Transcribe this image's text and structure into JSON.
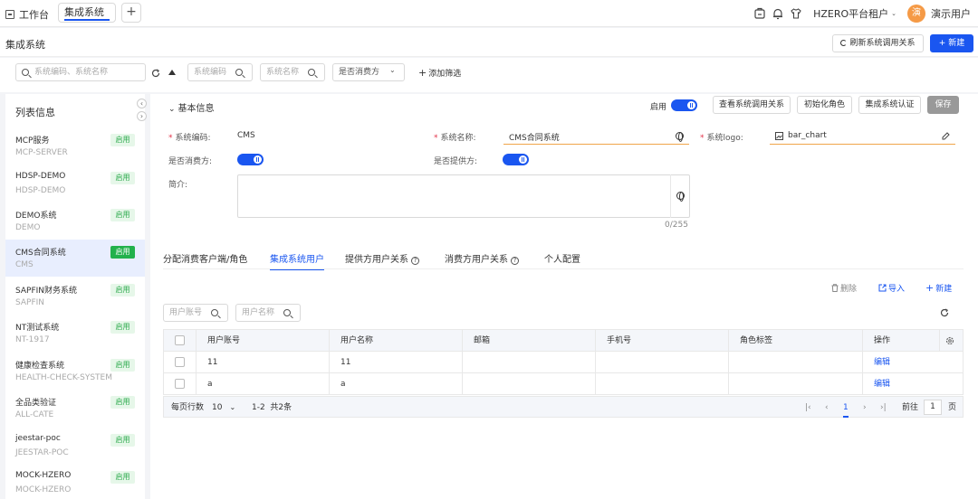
{
  "topbar": {
    "home_label": "工作台",
    "active_tab": "集成系统",
    "add_tab": "+",
    "tenant": "HZERO平台租户",
    "avatar_text": "演",
    "user_name": "演示用户"
  },
  "header": {
    "title": "集成系统",
    "refresh_label": "刷新系统调用关系",
    "new_label": "+ 新建"
  },
  "filters": {
    "search_placeholder": "系统编码、系统名称",
    "code_placeholder": "系统编码",
    "name_placeholder": "系统名称",
    "consumer_select": "是否消费方",
    "add_filter": "添加筛选"
  },
  "sidebar": {
    "title": "列表信息",
    "items": [
      {
        "name": "MCP服务",
        "code": "MCP-SERVER",
        "status": "启用"
      },
      {
        "name": "HDSP-DEMO",
        "code": "HDSP-DEMO",
        "status": "启用"
      },
      {
        "name": "DEMO系统",
        "code": "DEMO",
        "status": "启用"
      },
      {
        "name": "CMS合同系统",
        "code": "CMS",
        "status": "启用"
      },
      {
        "name": "SAPFIN财务系统",
        "code": "SAPFIN",
        "status": "启用"
      },
      {
        "name": "NT测试系统",
        "code": "NT-1917",
        "status": "启用"
      },
      {
        "name": "健康检查系统",
        "code": "HEALTH-CHECK-SYSTEM",
        "status": "启用"
      },
      {
        "name": "全品类验证",
        "code": "ALL-CATE",
        "status": "启用"
      },
      {
        "name": "jeestar-poc",
        "code": "JEESTAR-POC",
        "status": "启用"
      },
      {
        "name": "MOCK-HZERO",
        "code": "MOCK-HZERO",
        "status": "启用"
      }
    ]
  },
  "basic": {
    "section_title": "基本信息",
    "enabled_label": "启用",
    "btn_view_relations": "查看系统调用关系",
    "btn_init_roles": "初始化角色",
    "btn_auth": "集成系统认证",
    "btn_save": "保存",
    "code_label": "系统编码:",
    "code_value": "CMS",
    "name_label": "系统名称:",
    "name_value": "CMS合同系统",
    "logo_label": "系统logo:",
    "logo_value": "bar_chart",
    "consumer_label": "是否消费方:",
    "provider_label": "是否提供方:",
    "intro_label": "简介:",
    "intro_count": "0/255"
  },
  "tabs": [
    "分配消费客户端/角色",
    "集成系统用户",
    "提供方用户关系",
    "消费方用户关系",
    "个人配置"
  ],
  "actions": {
    "delete": "删除",
    "import": "导入",
    "new": "新建"
  },
  "user_filters": {
    "account_placeholder": "用户账号",
    "name_placeholder": "用户名称"
  },
  "table": {
    "headers": [
      "用户账号",
      "用户名称",
      "邮箱",
      "手机号",
      "角色标签",
      "操作"
    ],
    "rows": [
      {
        "account": "11",
        "name": "11",
        "email": "",
        "phone": "",
        "roles": "",
        "op": "编辑"
      },
      {
        "account": "a",
        "name": "a",
        "email": "",
        "phone": "",
        "roles": "",
        "op": "编辑"
      }
    ]
  },
  "pagination": {
    "per_page_label": "每页行数",
    "per_page": "10",
    "range": "1-2  共2条",
    "current": "1",
    "goto_label": "前往",
    "goto_value": "1",
    "page_suffix": "页"
  },
  "colors": {
    "primary": "#1a56f0",
    "success": "#22b14c",
    "required": "#e3344a",
    "underline": "#f0a54a"
  }
}
